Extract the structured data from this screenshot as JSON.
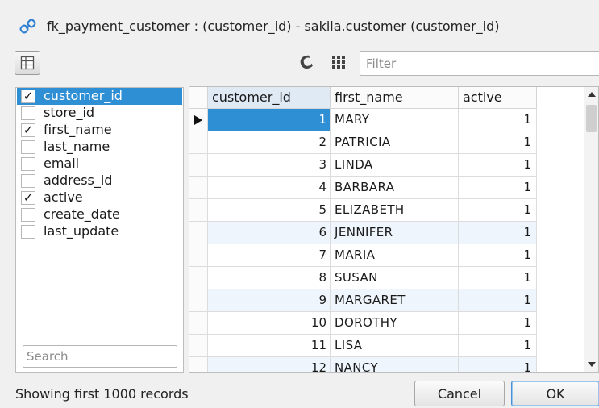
{
  "window": {
    "title": "fk_payment_customer : (customer_id) - sakila.customer (customer_id)",
    "icon": "link-icon"
  },
  "toolbar": {
    "columns_toggle_icon": "columns-panel-icon",
    "refresh_icon": "refresh-icon",
    "refresh_glyph": "C",
    "grid_icon": "grid-view-icon",
    "filter_placeholder": "Filter",
    "filter_value": ""
  },
  "columns": [
    {
      "name": "customer_id",
      "checked": true,
      "selected": true
    },
    {
      "name": "store_id",
      "checked": false,
      "selected": false
    },
    {
      "name": "first_name",
      "checked": true,
      "selected": false
    },
    {
      "name": "last_name",
      "checked": false,
      "selected": false
    },
    {
      "name": "email",
      "checked": false,
      "selected": false
    },
    {
      "name": "address_id",
      "checked": false,
      "selected": false
    },
    {
      "name": "active",
      "checked": true,
      "selected": false
    },
    {
      "name": "create_date",
      "checked": false,
      "selected": false
    },
    {
      "name": "last_update",
      "checked": false,
      "selected": false
    }
  ],
  "check_glyph": "✓",
  "search": {
    "placeholder": "Search",
    "value": ""
  },
  "table": {
    "headers": [
      "customer_id",
      "first_name",
      "active"
    ],
    "rows": [
      [
        "1",
        "MARY",
        "1"
      ],
      [
        "2",
        "PATRICIA",
        "1"
      ],
      [
        "3",
        "LINDA",
        "1"
      ],
      [
        "4",
        "BARBARA",
        "1"
      ],
      [
        "5",
        "ELIZABETH",
        "1"
      ],
      [
        "6",
        "JENNIFER",
        "1"
      ],
      [
        "7",
        "MARIA",
        "1"
      ],
      [
        "8",
        "SUSAN",
        "1"
      ],
      [
        "9",
        "MARGARET",
        "1"
      ],
      [
        "10",
        "DOROTHY",
        "1"
      ],
      [
        "11",
        "LISA",
        "1"
      ],
      [
        "12",
        "NANCY",
        "1"
      ]
    ],
    "current_row": 0,
    "highlighted_rows": [
      5,
      8,
      11
    ]
  },
  "status": {
    "text": "Showing first 1000 records"
  },
  "buttons": {
    "cancel": "Cancel",
    "ok": "OK"
  },
  "colors": {
    "accent": "#2f8fd5",
    "row_highlight": "#eef5fc"
  }
}
